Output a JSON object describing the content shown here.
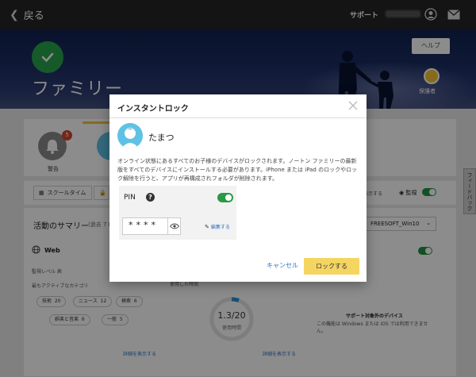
{
  "topbar": {
    "back_label": "戻る",
    "support_label": "サポート"
  },
  "hero": {
    "title": "ファミリー",
    "help_label": "ヘルプ",
    "guardian_label": "保護者"
  },
  "page": {
    "warning_count": "5",
    "warning_label": "警告",
    "school_time_label": "スクールタイム",
    "summary_title": "活動のサマリー",
    "summary_sub": "(過去 7 E",
    "device_selected": "FREESOFT_Win10",
    "web_label": "Web",
    "supervise_label": "監視",
    "show_details_label": "表示する",
    "monitor_level": "監視レベル 高",
    "top_active_categories": "最もアクティブなカテゴリ",
    "chips": [
      {
        "label": "技術",
        "count": "20"
      },
      {
        "label": "ニュース",
        "count": "12"
      },
      {
        "label": "検索",
        "count": "6"
      },
      {
        "label": "娯楽と音楽",
        "count": "6"
      },
      {
        "label": "一般",
        "count": "5"
      }
    ],
    "time_used_label": "使用した時間",
    "ring_value": "1.3/20",
    "ring_sub": "使用時間",
    "unsupported_title": "サポート対象外のデバイス",
    "unsupported_desc": "この機能は Windows または iOS では利用できません。",
    "details_link_1": "詳細を表示する",
    "details_link_2": "詳細を表示する",
    "feedback_label": "フィードバック"
  },
  "modal": {
    "title": "インスタントロック",
    "child_name": "たまつ",
    "description": "オンライン状態にあるすべてのお子様のデバイスがロックされます。ノートン ファミリーの最新版をすべてのデバイスにインストールする必要があります。iPhone または iPad のロックやロック解除を行うと、アプリが再構成されフォルダが削除されます。",
    "pin_label": "PIN",
    "pin_help": "?",
    "pin_value": "****",
    "edit_label": "編集する",
    "cancel_label": "キャンセル",
    "lock_label": "ロックする"
  },
  "colors": {
    "accent_yellow": "#f5d562",
    "toggle_green": "#2a9a46",
    "link_blue": "#2d73c4",
    "badge_red": "#d6452f"
  }
}
